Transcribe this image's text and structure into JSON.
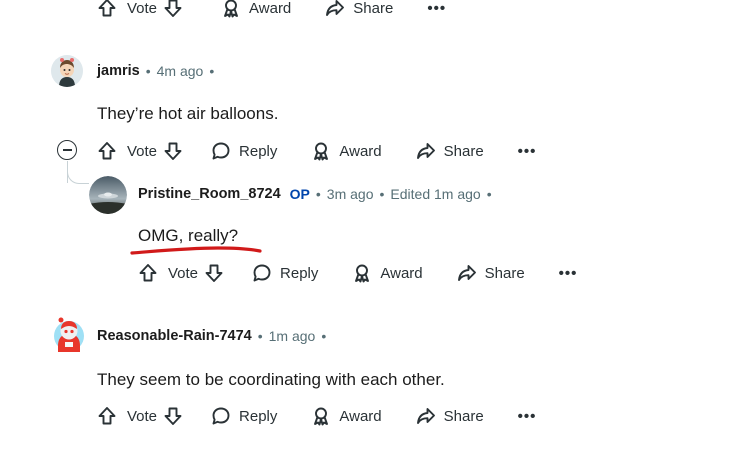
{
  "actions": {
    "vote": "Vote",
    "reply": "Reply",
    "award": "Award",
    "share": "Share",
    "more": "•••"
  },
  "comments": [
    {
      "author": "jamris",
      "time": "4m ago",
      "text": "They’re hot air balloons."
    },
    {
      "author": "Pristine_Room_8724",
      "badge": "OP",
      "time": "3m ago",
      "edited": "Edited 1m ago",
      "text": "OMG, really?"
    },
    {
      "author": "Reasonable-Rain-7474",
      "time": "1m ago",
      "text": "They seem to be coordinating with each other."
    }
  ],
  "colors": {
    "op_badge": "#0045ac",
    "annotation_underline": "#d11a1a",
    "meta_text": "#576f76"
  }
}
